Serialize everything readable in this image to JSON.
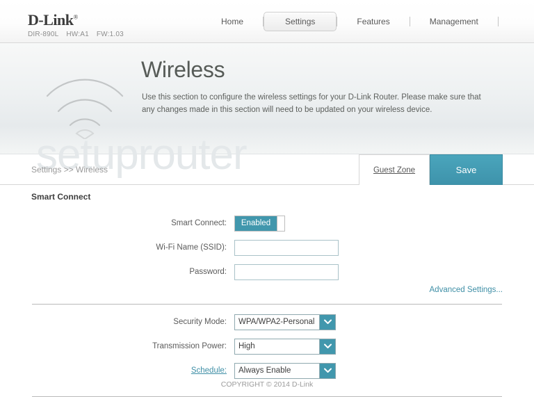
{
  "header": {
    "brand": "D-Link",
    "brand_reg": "®",
    "model": "DIR-890L",
    "hardware": "HW:A1",
    "firmware": "FW:1.03",
    "nav": [
      {
        "label": "Home",
        "active": false
      },
      {
        "label": "Settings",
        "active": true
      },
      {
        "label": "Features",
        "active": false
      },
      {
        "label": "Management",
        "active": false
      }
    ]
  },
  "hero": {
    "icon": "wifi-icon",
    "title": "Wireless",
    "description": "Use this section to configure the wireless settings for your D-Link Router. Please make sure that any changes made in this section will need to be updated on your wireless device."
  },
  "watermark": "setuprouter",
  "crumbbar": {
    "breadcrumb": "Settings >> Wireless",
    "guest_zone_label": "Guest Zone",
    "save_label": "Save"
  },
  "content": {
    "section_title": "Smart Connect",
    "smart_connect": {
      "label": "Smart Connect:",
      "value": "Enabled"
    },
    "ssid": {
      "label": "Wi-Fi Name (SSID):",
      "value": "",
      "placeholder": ""
    },
    "password": {
      "label": "Password:",
      "value": "",
      "placeholder": ""
    },
    "advanced_settings_label": "Advanced Settings...",
    "security_mode": {
      "label": "Security Mode:",
      "value": "WPA/WPA2-Personal"
    },
    "transmission_power": {
      "label": "Transmission Power:",
      "value": "High"
    },
    "schedule": {
      "label": "Schedule:",
      "value": "Always Enable"
    }
  },
  "footer": {
    "copyright": "COPYRIGHT © 2014 D-Link"
  },
  "colors": {
    "accent_teal": "#4197ad",
    "save_teal": "#4aa5bc",
    "link_teal": "#3f8fa6"
  }
}
